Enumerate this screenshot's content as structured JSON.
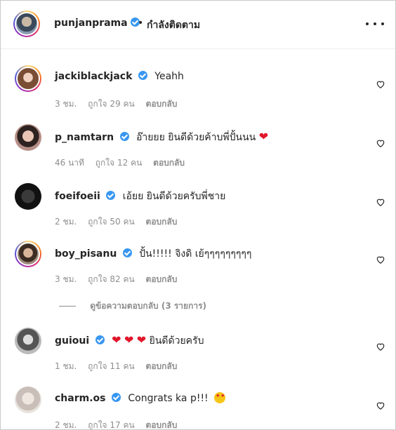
{
  "header": {
    "username": "punjanprama",
    "separator": "•",
    "follow_status": "กำลังติดตาม"
  },
  "comments": [
    {
      "username": "jackiblackjack",
      "text": "Yeahh",
      "time": "3 ชม.",
      "likes": "ถูกใจ 29 คน",
      "reply": "ตอบกลับ"
    },
    {
      "username": "p_namtarn",
      "text": "อ๊ายยย ยินดีด้วยค้าบพี่ปั้นนน",
      "time": "46 นาที",
      "likes": "ถูกใจ 12 คน",
      "reply": "ตอบกลับ"
    },
    {
      "username": "foeifoeii",
      "text": "เอ้ยย ยินดีด้วยครับพี่ชาย",
      "time": "2 ชม.",
      "likes": "ถูกใจ 50 คน",
      "reply": "ตอบกลับ"
    },
    {
      "username": "boy_pisanu",
      "text": "ปั้น!!!!! จิงดิ เย้ๆๆๆๆๆๆๆๆๆ",
      "time": "3 ชม.",
      "likes": "ถูกใจ 82 คน",
      "reply": "ตอบกลับ"
    },
    {
      "username": "guioui",
      "text": "ยินดีด้วยครับ",
      "time": "1 ชม.",
      "likes": "ถูกใจ 11 คน",
      "reply": "ตอบกลับ"
    },
    {
      "username": "charm.os",
      "text": "Congrats ka p!!!",
      "time": "2 ชม.",
      "likes": "ถูกใจ 17 คน",
      "reply": "ตอบกลับ"
    }
  ],
  "view_replies": "ดูข้อความตอบกลับ (3 รายการ)",
  "colors": {
    "verified": "#3897f0",
    "heart_emoji": "#e0162b",
    "meta_text": "#8e8e8e"
  }
}
